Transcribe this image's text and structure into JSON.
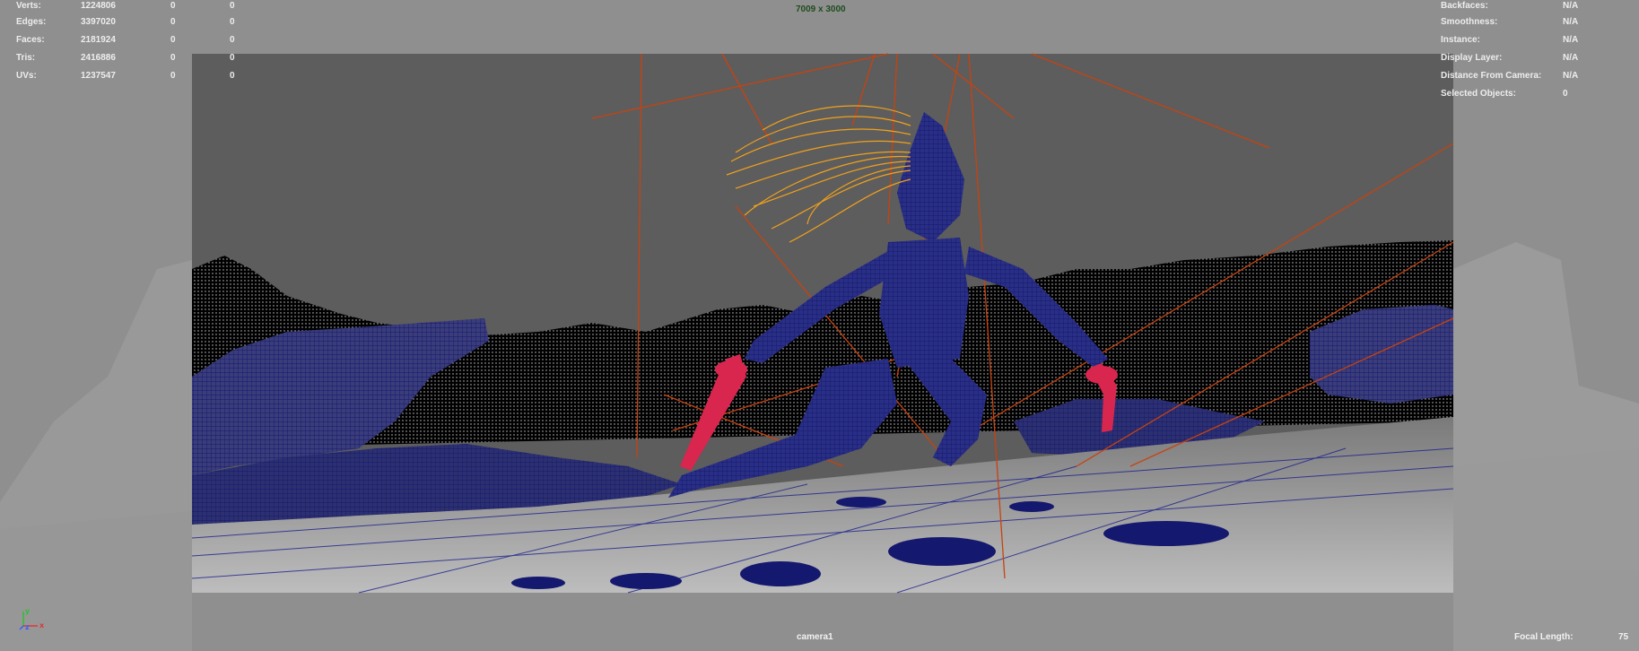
{
  "stats": [
    {
      "label": "Verts:",
      "v1": "1224806",
      "v2": "0",
      "v3": "0"
    },
    {
      "label": "Edges:",
      "v1": "3397020",
      "v2": "0",
      "v3": "0"
    },
    {
      "label": "Faces:",
      "v1": "2181924",
      "v2": "0",
      "v3": "0"
    },
    {
      "label": "Tris:",
      "v1": "2416886",
      "v2": "0",
      "v3": "0"
    },
    {
      "label": "UVs:",
      "v1": "1237547",
      "v2": "0",
      "v3": "0"
    }
  ],
  "info": [
    {
      "label": "Backfaces:",
      "value": "N/A"
    },
    {
      "label": "Smoothness:",
      "value": "N/A"
    },
    {
      "label": "Instance:",
      "value": "N/A"
    },
    {
      "label": "Display Layer:",
      "value": "N/A"
    },
    {
      "label": "Distance From Camera:",
      "value": "N/A"
    },
    {
      "label": "Selected Objects:",
      "value": "0"
    }
  ],
  "resolution": "7009 x 3000",
  "camera_name": "camera1",
  "focal_length_label": "Focal Length:",
  "focal_length_value": "75",
  "colors": {
    "viewport_bg": "#8f8f8f",
    "gate_bg": "#5f5f5f",
    "wire": "#1a1f8c",
    "hair": "#f2a11a",
    "rig_lines": "#c8420e",
    "swords": "#d8264e"
  },
  "icons": {
    "axis": "xyz-axis-gizmo-icon"
  }
}
